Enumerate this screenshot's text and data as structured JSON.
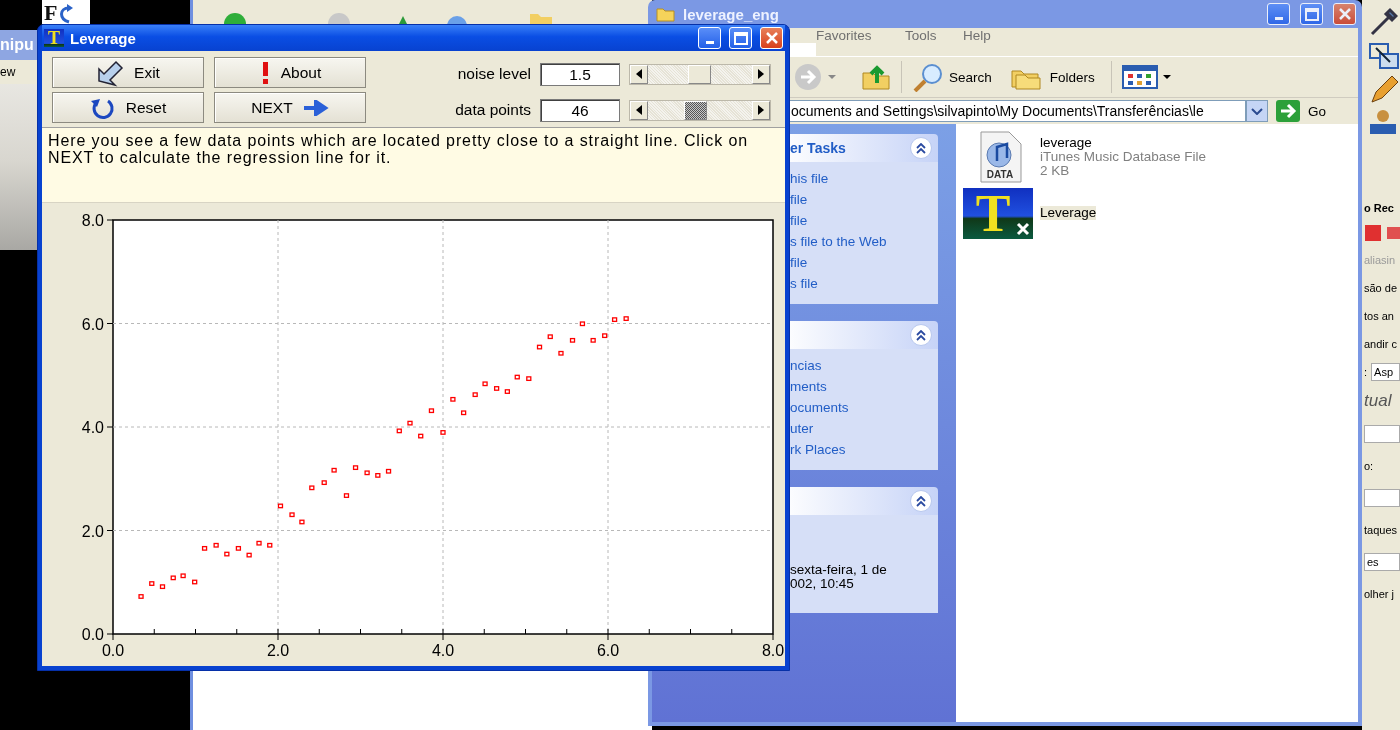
{
  "left_window": {
    "title": "nipu",
    "menu": "ew"
  },
  "logo_tile": {
    "letter": "F"
  },
  "explorer": {
    "title": "leverage_eng",
    "menu": [
      "Favorites",
      "Tools",
      "Help"
    ],
    "toolbar": [
      "Search",
      "Folders"
    ],
    "address": "ocuments and Settings\\silvapinto\\My Documents\\Transferências\\le",
    "go": "Go",
    "task_panels": [
      {
        "title": "er Tasks",
        "items": [
          "his file",
          "file",
          "file",
          "s file to the Web",
          "file",
          "s file"
        ]
      },
      {
        "items": [
          "ncias",
          "ments",
          "ocuments",
          "uter",
          "rk Places"
        ]
      },
      {
        "details": [
          "sexta-feira, 1 de",
          "002, 10:45"
        ]
      }
    ],
    "files": [
      {
        "kind": "data",
        "icon_label": "DATA",
        "name": "leverage",
        "type": "iTunes Music Database File",
        "size": "2 KB",
        "selected": false
      },
      {
        "kind": "app",
        "icon_letter": "T",
        "name": "Leverage",
        "selected": true
      }
    ]
  },
  "side_panel": {
    "rows": [
      {
        "kind": "heading",
        "text": "o Rec"
      },
      {
        "kind": "buttons"
      },
      {
        "kind": "muted",
        "text": "aliasin"
      },
      {
        "kind": "text",
        "text": "são de"
      },
      {
        "kind": "text",
        "text": "tos an"
      },
      {
        "kind": "text",
        "text": "andir c"
      },
      {
        "kind": "labeled_field",
        "label": ":",
        "value": "Asp"
      },
      {
        "kind": "italic",
        "text": "tual"
      },
      {
        "kind": "field"
      },
      {
        "kind": "text",
        "text": "o:"
      },
      {
        "kind": "field"
      },
      {
        "kind": "text",
        "text": "taques"
      },
      {
        "kind": "field",
        "value": "es"
      },
      {
        "kind": "text",
        "text": "olher j"
      }
    ]
  },
  "leverage": {
    "title": "Leverage",
    "icon_letter": "T",
    "buttons": [
      {
        "label": "Exit",
        "kind": "exit"
      },
      {
        "label": "About",
        "kind": "about"
      },
      {
        "label": "Reset",
        "kind": "reset"
      },
      {
        "label": "NEXT",
        "kind": "next"
      }
    ],
    "controls": [
      {
        "label": "noise level",
        "value": "1.5",
        "level": 0.49,
        "focused": false
      },
      {
        "label": "data points",
        "value": "46",
        "level": 0.44,
        "focused": true
      }
    ],
    "message": "Here you see a few data points which are located pretty close to a straight line. Click on NEXT to calculate the regression line for it.",
    "chart_data": {
      "type": "scatter",
      "grid": true,
      "xlim": [
        0,
        8
      ],
      "ylim": [
        0,
        8
      ],
      "xticks": [
        {
          "value": 0,
          "label": "0.0"
        },
        {
          "value": 2,
          "label": "2.0"
        },
        {
          "value": 4,
          "label": "4.0"
        },
        {
          "value": 6,
          "label": "6.0"
        },
        {
          "value": 8,
          "label": "8.0"
        }
      ],
      "yticks": [
        {
          "value": 0,
          "label": "0.0"
        },
        {
          "value": 2,
          "label": "2.0"
        },
        {
          "value": 4,
          "label": "4.0"
        },
        {
          "value": 6,
          "label": "6.0"
        },
        {
          "value": 8,
          "label": "8.0"
        }
      ],
      "x": [
        0.34,
        0.47,
        0.6,
        0.73,
        0.85,
        0.99,
        1.11,
        1.25,
        1.38,
        1.52,
        1.65,
        1.77,
        1.9,
        2.03,
        2.17,
        2.29,
        2.41,
        2.56,
        2.68,
        2.83,
        2.94,
        3.08,
        3.21,
        3.34,
        3.47,
        3.6,
        3.73,
        3.86,
        4.0,
        4.12,
        4.25,
        4.39,
        4.51,
        4.65,
        4.78,
        4.9,
        5.04,
        5.17,
        5.3,
        5.43,
        5.57,
        5.69,
        5.82,
        5.96,
        6.08,
        6.22
      ],
      "values": [
        0.72,
        0.97,
        0.91,
        1.08,
        1.12,
        1.0,
        1.65,
        1.71,
        1.54,
        1.65,
        1.52,
        1.75,
        1.71,
        2.47,
        2.3,
        2.16,
        2.82,
        2.92,
        3.16,
        2.67,
        3.21,
        3.11,
        3.06,
        3.14,
        3.92,
        4.07,
        3.82,
        4.31,
        3.89,
        4.53,
        4.27,
        4.62,
        4.83,
        4.74,
        4.68,
        4.96,
        4.93,
        5.54,
        5.74,
        5.42,
        5.67,
        5.99,
        5.67,
        5.76,
        6.07,
        6.09
      ]
    }
  }
}
